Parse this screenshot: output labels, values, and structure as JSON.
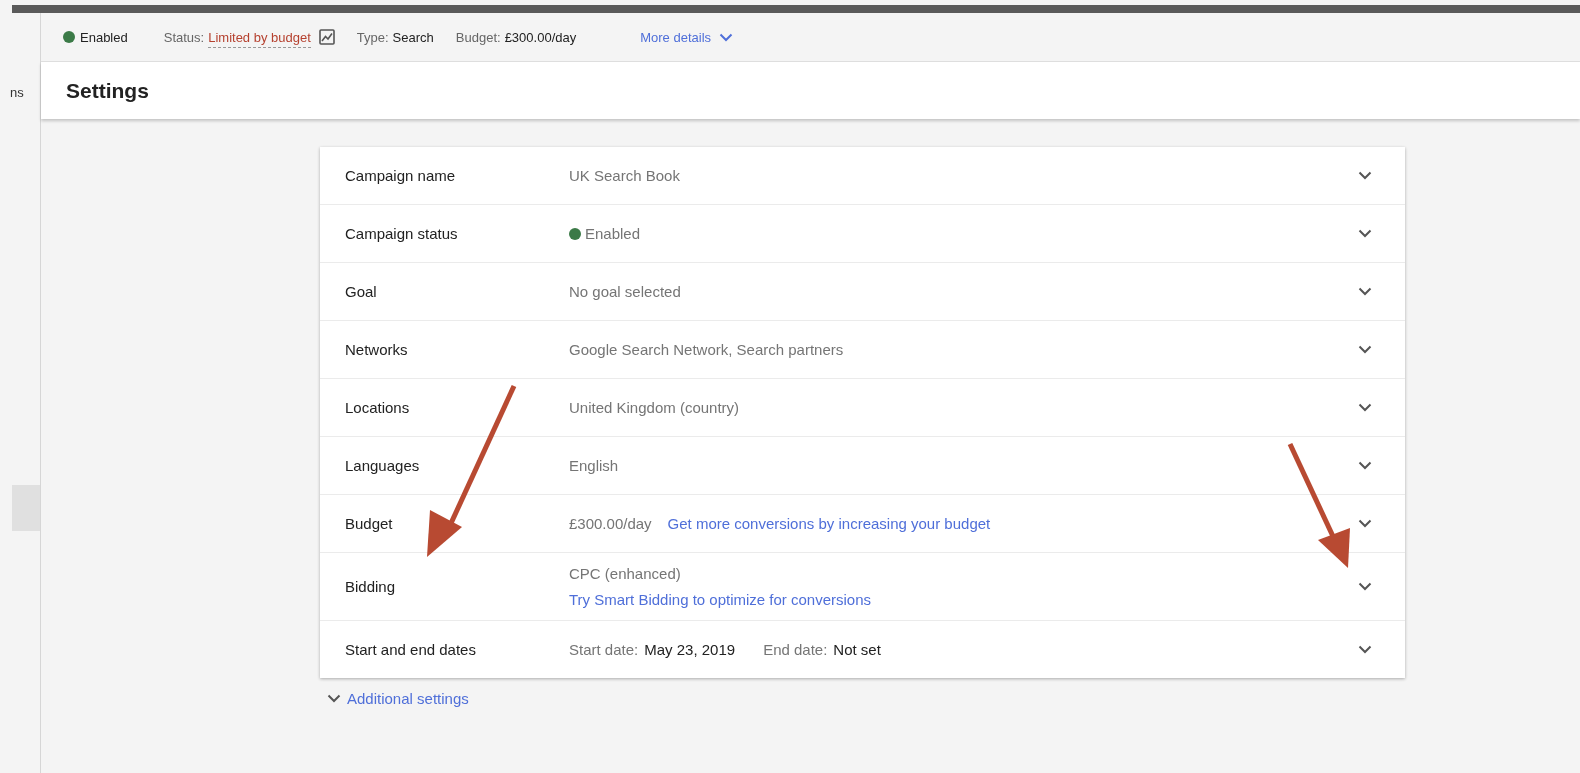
{
  "sidebar": {
    "cut_text": "ns"
  },
  "summary_bar": {
    "status": {
      "text": "Enabled",
      "color": "#3b7a47"
    },
    "fields": [
      {
        "label": "Status:",
        "value": "Limited by budget",
        "kind": "warning"
      },
      {
        "label": "Type:",
        "value": "Search",
        "kind": "plain"
      },
      {
        "label": "Budget:",
        "value": "£300.00/day",
        "kind": "plain"
      }
    ],
    "more_details": "More details"
  },
  "page_title": "Settings",
  "settings": [
    {
      "label": "Campaign name",
      "expanded": false,
      "lines": [
        [
          {
            "text": "UK Search Book",
            "kind": "muted"
          }
        ]
      ]
    },
    {
      "label": "Campaign status",
      "expanded": false,
      "color": "#3b7a47",
      "lines": [
        [
          {
            "text": "Enabled",
            "kind": "muted"
          }
        ]
      ]
    },
    {
      "label": "Goal",
      "expanded": false,
      "lines": [
        [
          {
            "text": "No goal selected",
            "kind": "muted"
          }
        ]
      ]
    },
    {
      "label": "Networks",
      "expanded": false,
      "lines": [
        [
          {
            "text": "Google Search Network, Search partners",
            "kind": "muted"
          }
        ]
      ]
    },
    {
      "label": "Locations",
      "expanded": false,
      "lines": [
        [
          {
            "text": "United Kingdom (country)",
            "kind": "muted"
          }
        ]
      ]
    },
    {
      "label": "Languages",
      "expanded": false,
      "lines": [
        [
          {
            "text": "English",
            "kind": "muted"
          }
        ]
      ]
    },
    {
      "label": "Budget",
      "expanded": false,
      "lines": [
        [
          {
            "text": "£300.00/day",
            "kind": "muted"
          },
          {
            "text": "Get more conversions by increasing your budget",
            "kind": "link"
          }
        ]
      ]
    },
    {
      "label": "Bidding",
      "expanded": false,
      "lines": [
        [
          {
            "text": "CPC (enhanced)",
            "kind": "muted"
          }
        ],
        [
          {
            "text": "Try Smart Bidding to optimize for conversions",
            "kind": "link"
          }
        ]
      ]
    },
    {
      "label": "Start and end dates",
      "expanded": false,
      "lines": [
        [
          {
            "text": "Start date:",
            "kind": "muted"
          },
          {
            "text": "May 23, 2019",
            "kind": "strong"
          },
          {
            "text": "End date:",
            "kind": "muted"
          },
          {
            "text": "Not set",
            "kind": "strong"
          }
        ]
      ]
    }
  ],
  "additional_settings": {
    "text": "Additional settings",
    "expanded": false
  }
}
